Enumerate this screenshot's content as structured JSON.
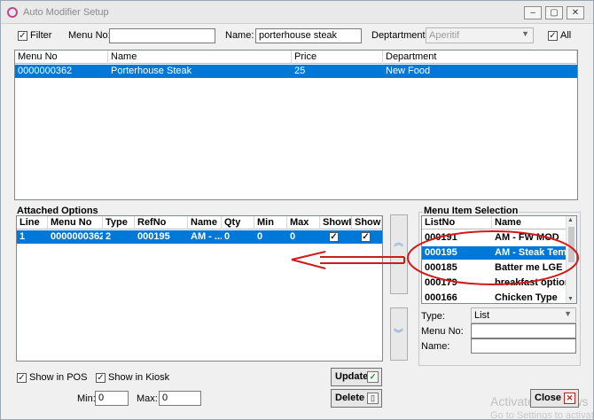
{
  "window": {
    "title": "Auto Modifier Setup",
    "minimize_glyph": "–",
    "restore_glyph": "▢",
    "close_glyph": "✕"
  },
  "filter": {
    "filter_label": "Filter",
    "filter_checked": true,
    "menu_no_label": "Menu No:",
    "menu_no_value": "",
    "name_label": "Name:",
    "name_value": "porterhouse steak",
    "department_label": "Deptartment:",
    "department_value": "Aperitif",
    "all_label": "All",
    "all_checked": true
  },
  "menu_grid": {
    "headers": [
      "Menu No",
      "Name",
      "Price",
      "Department"
    ],
    "rows": [
      {
        "menu_no": "0000000362",
        "name": "Porterhouse Steak",
        "price": "25",
        "department": "New Food"
      }
    ]
  },
  "attached_options": {
    "title": "Attached Options",
    "headers": [
      "Line",
      "Menu No",
      "Type",
      "RefNo",
      "Name",
      "Qty",
      "Min",
      "Max",
      "ShowIr",
      "ShowIr"
    ],
    "rows": [
      {
        "line": "1",
        "menu_no": "0000000362",
        "type": "2",
        "refno": "000195",
        "name": "AM - ...",
        "qty": "0",
        "min": "0",
        "max": "0",
        "show1": "✓",
        "show2": "✓"
      }
    ]
  },
  "menu_item_selection": {
    "title": "Menu Item Selection",
    "headers": [
      "ListNo",
      "Name"
    ],
    "rows": [
      {
        "listno": "000191",
        "name": "AM - FW MOD"
      },
      {
        "listno": "000195",
        "name": "AM - Steak Temp"
      },
      {
        "listno": "000185",
        "name": "Batter me LGE"
      },
      {
        "listno": "000179",
        "name": "breakfast options"
      },
      {
        "listno": "000166",
        "name": "Chicken Type"
      }
    ],
    "type_label": "Type:",
    "type_value": "List",
    "menu_no_label": "Menu No:",
    "menu_no_value": "",
    "name_label": "Name:",
    "name_value": ""
  },
  "bottom": {
    "show_pos_label": "Show in POS",
    "show_pos_checked": true,
    "show_kiosk_label": "Show in Kiosk",
    "show_kiosk_checked": true,
    "min_label": "Min:",
    "min_value": "0",
    "max_label": "Max:",
    "max_value": "0",
    "update_label": "Update",
    "delete_label": "Delete",
    "close_label": "Close"
  },
  "watermark": {
    "line1": "Activate Windows",
    "line2": "Go to Settings to activate"
  },
  "colors": {
    "selection": "#0078d7",
    "annotation": "#d11a1a",
    "arrow_button": "#5a8fd0"
  }
}
